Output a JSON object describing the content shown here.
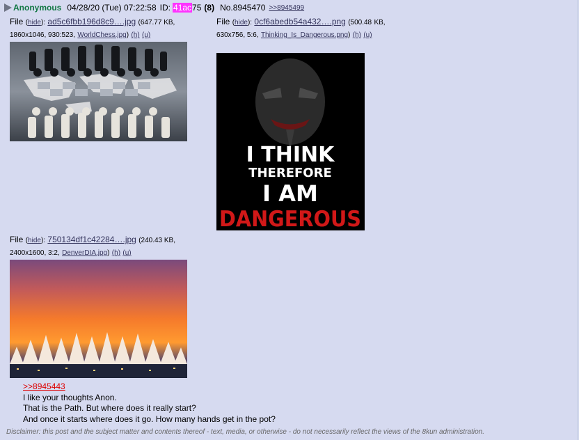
{
  "post": {
    "name": "Anonymous",
    "datetime": "04/28/20 (Tue) 07:22:58",
    "id_label": "ID:",
    "id_highlight": "41ac",
    "id_rest": "75",
    "post_count": "(8)",
    "number": "No.8945470",
    "backlink": ">>8945499"
  },
  "files": [
    {
      "label": "File",
      "hide": "hide",
      "filename": "ad5c6fbb196d8c9….jpg",
      "info": "(647.77 KB, 1860x1046, 930:523,",
      "original": "WorldChess.jpg",
      "h": "(h)",
      "u": "(u)"
    },
    {
      "label": "File",
      "hide": "hide",
      "filename": "0cf6abedb54a432….png",
      "info_1": "(500.48",
      "info_2": "KB, 630x756, 5:6,",
      "original": "Thinking_Is_Dangerous.png",
      "h": "(h)",
      "u": "(u)",
      "image_text": [
        "I THINK",
        "THEREFORE",
        "I AM",
        "DANGEROUS"
      ]
    },
    {
      "label": "File",
      "hide": "hide",
      "filename": "750134df1c42284….jpg",
      "info": "(240.43 KB, 2400x1600, 3:2,",
      "original": "DenverDIA.jpg",
      "h": "(h)",
      "u": "(u)"
    }
  ],
  "body": {
    "quote": ">>8945443",
    "lines": [
      "I like your thoughts Anon.",
      "That is the Path. But where does it really start?",
      "And once it starts where does it go. How many hands get in the pot?"
    ]
  },
  "disclaimer": "Disclaimer: this post and the subject matter and contents thereof - text, media, or otherwise - do not necessarily reflect the views of the 8kun administration.",
  "colors": {
    "background": "#d6daf0",
    "name": "#117743",
    "id_highlight": "#ff33ff",
    "quotelink": "#dd0000",
    "link": "#34345c"
  }
}
